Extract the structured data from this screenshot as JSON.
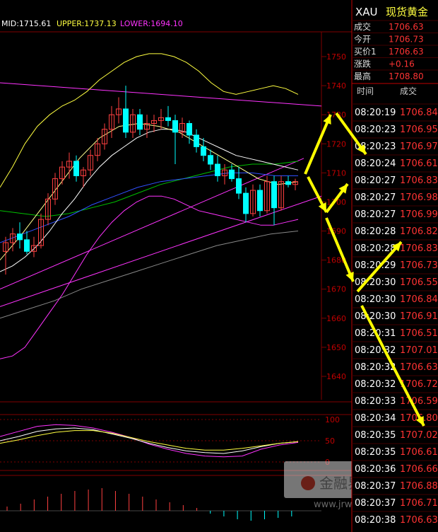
{
  "chart_data": {
    "type": "candlestick",
    "indicator": {
      "mid_label": "MID:1715.61",
      "upper_label": "UPPER:1737.13",
      "lower_label": "LOWER:1694.10"
    },
    "price_axis": {
      "ticks": [
        1750,
        1740,
        1730,
        1720,
        1710,
        1700,
        1690,
        1680,
        1670,
        1660,
        1650,
        1640
      ],
      "range": [
        1630,
        1755
      ]
    },
    "oscillator_axis": {
      "ticks": [
        100,
        50,
        0
      ]
    },
    "candles": [
      {
        "o": 1683,
        "h": 1688,
        "l": 1675,
        "c": 1686
      },
      {
        "o": 1686,
        "h": 1691,
        "l": 1683,
        "c": 1689
      },
      {
        "o": 1689,
        "h": 1693,
        "l": 1684,
        "c": 1687
      },
      {
        "o": 1687,
        "h": 1690,
        "l": 1682,
        "c": 1683
      },
      {
        "o": 1683,
        "h": 1688,
        "l": 1681,
        "c": 1685
      },
      {
        "o": 1685,
        "h": 1696,
        "l": 1684,
        "c": 1694
      },
      {
        "o": 1694,
        "h": 1703,
        "l": 1692,
        "c": 1701
      },
      {
        "o": 1701,
        "h": 1710,
        "l": 1699,
        "c": 1708
      },
      {
        "o": 1708,
        "h": 1714,
        "l": 1706,
        "c": 1712
      },
      {
        "o": 1712,
        "h": 1717,
        "l": 1708,
        "c": 1714
      },
      {
        "o": 1714,
        "h": 1716,
        "l": 1707,
        "c": 1709
      },
      {
        "o": 1709,
        "h": 1712,
        "l": 1705,
        "c": 1711
      },
      {
        "o": 1711,
        "h": 1718,
        "l": 1709,
        "c": 1716
      },
      {
        "o": 1716,
        "h": 1722,
        "l": 1714,
        "c": 1720
      },
      {
        "o": 1720,
        "h": 1727,
        "l": 1718,
        "c": 1725
      },
      {
        "o": 1725,
        "h": 1733,
        "l": 1722,
        "c": 1730
      },
      {
        "o": 1730,
        "h": 1736,
        "l": 1727,
        "c": 1732
      },
      {
        "o": 1732,
        "h": 1740,
        "l": 1722,
        "c": 1724
      },
      {
        "o": 1724,
        "h": 1732,
        "l": 1722,
        "c": 1730
      },
      {
        "o": 1730,
        "h": 1732,
        "l": 1723,
        "c": 1725
      },
      {
        "o": 1725,
        "h": 1730,
        "l": 1722,
        "c": 1727
      },
      {
        "o": 1727,
        "h": 1730,
        "l": 1724,
        "c": 1728
      },
      {
        "o": 1728,
        "h": 1732,
        "l": 1725,
        "c": 1729
      },
      {
        "o": 1729,
        "h": 1733,
        "l": 1726,
        "c": 1728
      },
      {
        "o": 1728,
        "h": 1730,
        "l": 1713,
        "c": 1724
      },
      {
        "o": 1724,
        "h": 1729,
        "l": 1722,
        "c": 1727
      },
      {
        "o": 1727,
        "h": 1728,
        "l": 1720,
        "c": 1723
      },
      {
        "o": 1723,
        "h": 1725,
        "l": 1717,
        "c": 1719
      },
      {
        "o": 1719,
        "h": 1722,
        "l": 1714,
        "c": 1716
      },
      {
        "o": 1716,
        "h": 1718,
        "l": 1711,
        "c": 1713
      },
      {
        "o": 1713,
        "h": 1716,
        "l": 1707,
        "c": 1709
      },
      {
        "o": 1709,
        "h": 1713,
        "l": 1706,
        "c": 1711
      },
      {
        "o": 1711,
        "h": 1713,
        "l": 1707,
        "c": 1708
      },
      {
        "o": 1708,
        "h": 1712,
        "l": 1701,
        "c": 1703
      },
      {
        "o": 1703,
        "h": 1705,
        "l": 1693,
        "c": 1696
      },
      {
        "o": 1696,
        "h": 1706,
        "l": 1695,
        "c": 1704
      },
      {
        "o": 1704,
        "h": 1706,
        "l": 1695,
        "c": 1697
      },
      {
        "o": 1697,
        "h": 1709,
        "l": 1696,
        "c": 1707
      },
      {
        "o": 1707,
        "h": 1709,
        "l": 1692,
        "c": 1698
      },
      {
        "o": 1698,
        "h": 1709,
        "l": 1697,
        "c": 1707
      },
      {
        "o": 1707,
        "h": 1709,
        "l": 1705,
        "c": 1706
      },
      {
        "o": 1706,
        "h": 1708,
        "l": 1704,
        "c": 1707
      }
    ],
    "bollinger_upper": [
      1705,
      1712,
      1720,
      1726,
      1730,
      1733,
      1735,
      1738,
      1742,
      1745,
      1748,
      1750,
      1751,
      1751,
      1750,
      1748,
      1745,
      1741,
      1738,
      1737,
      1738,
      1739,
      1740,
      1739,
      1737
    ],
    "bollinger_mid": [
      1676,
      1678,
      1681,
      1685,
      1690,
      1696,
      1701,
      1707,
      1712,
      1716,
      1719,
      1722,
      1724,
      1725,
      1725,
      1724,
      1722,
      1720,
      1718,
      1716,
      1715,
      1714,
      1713,
      1712,
      1711
    ],
    "bollinger_lower": [
      1646,
      1647,
      1650,
      1656,
      1662,
      1668,
      1675,
      1682,
      1688,
      1693,
      1697,
      1700,
      1702,
      1702,
      1701,
      1699,
      1697,
      1696,
      1695,
      1694,
      1693,
      1692,
      1692,
      1693,
      1694
    ],
    "ma_green": [
      1697,
      1696,
      1695,
      1696,
      1698,
      1700,
      1703,
      1706,
      1708,
      1710,
      1712,
      1713,
      1713,
      1714
    ],
    "ma_blue": [
      1686,
      1689,
      1692,
      1695,
      1699,
      1702,
      1705,
      1707,
      1708,
      1709,
      1710,
      1710,
      1709,
      1709
    ],
    "ma_gray": [
      1660,
      1663,
      1666,
      1670,
      1673,
      1676,
      1679,
      1682,
      1685,
      1687,
      1689,
      1690
    ],
    "ma_white_short": [
      1680,
      1688,
      1697,
      1706,
      1715,
      1722,
      1726,
      1727,
      1726,
      1724,
      1720,
      1716,
      1712,
      1708,
      1706,
      1707
    ],
    "oscillator_series": [
      {
        "color": "#ff33ff",
        "values": [
          60,
          72,
          84,
          88,
          86,
          80,
          70,
          58,
          42,
          30,
          20,
          14,
          12,
          14,
          30,
          40,
          46
        ]
      },
      {
        "color": "#ffffff",
        "values": [
          50,
          60,
          72,
          78,
          80,
          76,
          66,
          56,
          44,
          34,
          26,
          22,
          20,
          26,
          36,
          44,
          48
        ]
      },
      {
        "color": "#ffff40",
        "values": [
          44,
          52,
          62,
          70,
          74,
          74,
          68,
          58,
          48,
          40,
          32,
          28,
          28,
          32,
          38,
          44,
          48
        ]
      }
    ],
    "macd_bars": [
      3,
      5,
      8,
      10,
      12,
      14,
      15,
      16,
      14,
      12,
      10,
      8,
      6,
      4,
      2,
      -2,
      -4,
      -6,
      -7,
      -6,
      -5,
      -4
    ]
  },
  "quote_header": {
    "symbol": "XAU",
    "name": "现货黄金",
    "rows": [
      {
        "label": "成交",
        "value": "1706.63"
      },
      {
        "label": "今开",
        "value": "1706.73"
      },
      {
        "label": "买价1",
        "value": "1706.63"
      },
      {
        "label": "涨跌",
        "value": "+0.16"
      },
      {
        "label": "最高",
        "value": "1708.80"
      }
    ]
  },
  "tick_table": {
    "header_time": "时间",
    "header_price": "成交",
    "rows": [
      {
        "t": "08:20:19",
        "p": "1706.84"
      },
      {
        "t": "08:20:23",
        "p": "1706.95"
      },
      {
        "t": "08:20:23",
        "p": "1706.97"
      },
      {
        "t": "08:20:24",
        "p": "1706.61"
      },
      {
        "t": "08:20:27",
        "p": "1706.83"
      },
      {
        "t": "08:20:27",
        "p": "1706.98"
      },
      {
        "t": "08:20:27",
        "p": "1706.99"
      },
      {
        "t": "08:20:28",
        "p": "1706.82"
      },
      {
        "t": "08:20:28",
        "p": "1706.83"
      },
      {
        "t": "08:20:29",
        "p": "1706.73"
      },
      {
        "t": "08:20:30",
        "p": "1706.55"
      },
      {
        "t": "08:20:30",
        "p": "1706.84"
      },
      {
        "t": "08:20:30",
        "p": "1706.91"
      },
      {
        "t": "08:20:31",
        "p": "1706.51"
      },
      {
        "t": "08:20:32",
        "p": "1707.01"
      },
      {
        "t": "08:20:32",
        "p": "1706.63"
      },
      {
        "t": "08:20:32",
        "p": "1706.72"
      },
      {
        "t": "08:20:33",
        "p": "1706.59"
      },
      {
        "t": "08:20:34",
        "p": "1706.80"
      },
      {
        "t": "08:20:35",
        "p": "1707.02"
      },
      {
        "t": "08:20:35",
        "p": "1706.61"
      },
      {
        "t": "08:20:36",
        "p": "1706.66"
      },
      {
        "t": "08:20:37",
        "p": "1706.88"
      },
      {
        "t": "08:20:37",
        "p": "1706.71"
      },
      {
        "t": "08:20:38",
        "p": "1706.63"
      }
    ]
  },
  "watermark": {
    "brand": "金融界",
    "url": "www.jrwei.com"
  },
  "colors": {
    "up": "#ff4040",
    "down": "#00ffff",
    "mid": "#ffffff",
    "upper": "#ffff40",
    "lower": "#ff33ff",
    "grid": "#800000",
    "axis_text": "#c00000",
    "arrow": "#ffff00",
    "price_text": "#ff3333"
  }
}
